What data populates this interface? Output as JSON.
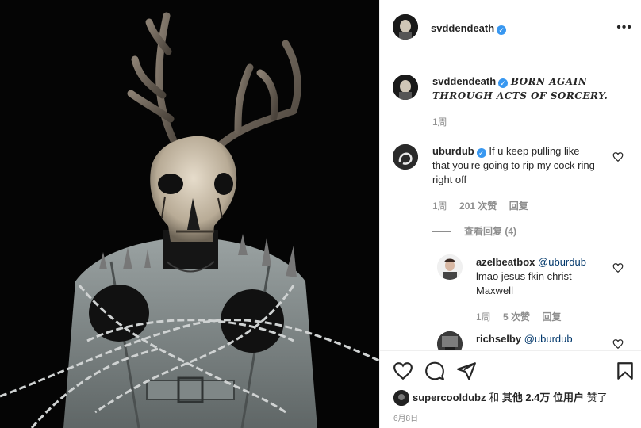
{
  "post_author": {
    "username": "svddendeath",
    "verified": true
  },
  "header_more_icon": "more-horizontal-icon",
  "caption": {
    "username": "svddendeath",
    "text": "BORN AGAIN THROUGH ACTS OF SORCERY.",
    "time": "1周"
  },
  "comments": [
    {
      "username": "uburdub",
      "verified": true,
      "text": "If u keep pulling like that you're going to rip my cock ring right off",
      "time": "1周",
      "likes": "201 次赞",
      "reply_label": "回复",
      "view_replies": "查看回复 (4)",
      "replies": [
        {
          "username": "azelbeatbox",
          "mention": "@uburdub",
          "text": "lmao jesus fkin christ Maxwell",
          "time": "1周",
          "likes": "5 次赞",
          "reply_label": "回复"
        },
        {
          "username": "richselby",
          "mention": "@uburdub"
        }
      ]
    }
  ],
  "actions": {
    "icons": [
      "heart-icon",
      "comment-icon",
      "share-icon",
      "bookmark-icon"
    ]
  },
  "likes_line": {
    "avatar_user": "supercooldubz",
    "connector": "和",
    "others": "其他 2.4万 位用户",
    "suffix": "赞了"
  },
  "post_date": "6月8日",
  "colors": {
    "verified_blue": "#3897f0",
    "muted": "#8e8e8e",
    "link": "#00376b",
    "photo_bg": "#050505"
  }
}
